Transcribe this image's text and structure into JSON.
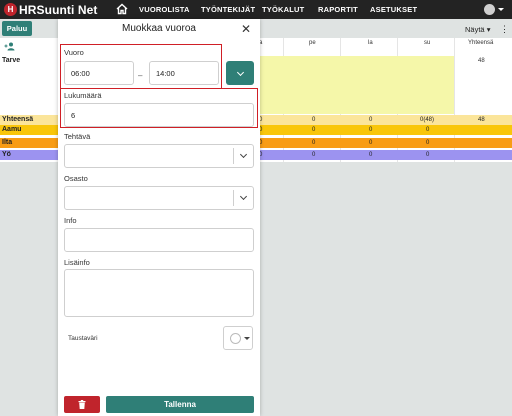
{
  "app": {
    "logo_mark": "H",
    "logo_text": "HRSuunti Net"
  },
  "nav": {
    "items": [
      "VUOROLISTA",
      "TYÖNTEKIJÄT",
      "TYÖKALUT",
      "RAPORTIT",
      "ASETUKSET"
    ]
  },
  "page": {
    "back_button": "Paluu",
    "show_label": "Näytä",
    "show_caret": "▾",
    "more_menu": "⋮",
    "add_person_icon": "person-add-icon",
    "headers": {
      "a": "a",
      "pe": "pe",
      "la": "la",
      "su": "su",
      "total": "Yhteensä"
    },
    "rows": {
      "tarve": "Tarve",
      "tarve_total": "48",
      "yhteensa": "Yhteensä",
      "aamu": "Aamu",
      "ilta": "Ilta",
      "yo": "Yö"
    },
    "yhteensa_values": {
      "a": "0",
      "pe": "0",
      "la": "0",
      "su": "0(48)",
      "total": "48"
    },
    "aamu_values": {
      "a": "0",
      "pe": "0",
      "la": "0",
      "su": "0"
    },
    "ilta_values": {
      "a": "0",
      "pe": "0",
      "la": "0",
      "su": "0"
    },
    "yo_values": {
      "a": "0",
      "pe": "0",
      "la": "0",
      "su": "0"
    },
    "colors": {
      "yhteensa": "#fbe59a",
      "aamu": "#f9c60a",
      "ilta": "#f89c14",
      "yo": "#9c93f0",
      "tarve": "#f5f7a9",
      "accent": "#2f7f77"
    }
  },
  "modal": {
    "title": "Muokkaa vuoroa",
    "close": "✕",
    "shift_label": "Vuoro",
    "start_time": "06:00",
    "separator": "–",
    "end_time": "14:00",
    "count_label": "Lukumäärä",
    "count_value": "6",
    "task_label": "Tehtävä",
    "task_value": "",
    "dept_label": "Osasto",
    "dept_value": "",
    "info_label": "Info",
    "info_value": "",
    "extra_label": "Lisäinfo",
    "extra_value": "",
    "bg_color_label": "Taustaväri",
    "save_label": "Tallenna",
    "delete_icon": "trash-icon"
  }
}
